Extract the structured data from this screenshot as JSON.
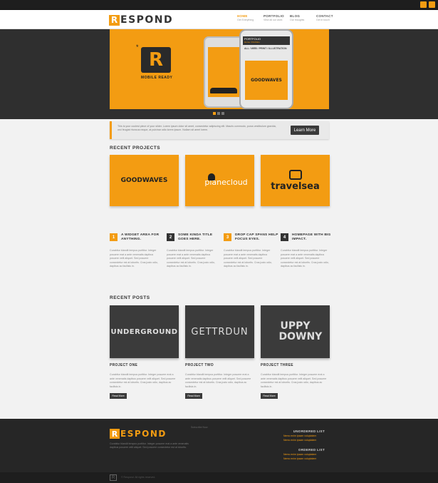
{
  "header": {
    "logo_letter": "R",
    "logo_text": "ESPOND",
    "nav": [
      {
        "label": "HOME",
        "sub": "Get Everything"
      },
      {
        "label": "PORTFOLIO",
        "sub": "View all our work"
      },
      {
        "label": "BLOG",
        "sub": "Our thoughts"
      },
      {
        "label": "CONTACT",
        "sub": "Get in touch"
      }
    ]
  },
  "slider": {
    "badge_letter": "R",
    "badge_star": "*",
    "mobile_ready": "MOBILE READY",
    "phone_bar": "PORTFOLIO",
    "phone_bar_sub": "Home / Portfolio",
    "phone_filter": "ALL / WEB / PRINT / ILLUSTRATION",
    "phone_screen": "GOODWAVES"
  },
  "callout": {
    "text": "This is your coolest piece of your slider. Lorem ipsum dolor sit amet, consectetur adipiscing elit. Mauris commodo, purus vestibulum gravida, orci feugiat rhoncus neque, at pulvinar odio lorem ipsum. Nullam sit amet lorem.",
    "button": "Learn More"
  },
  "recent_projects": {
    "title": "RECENT PROJECTS",
    "items": [
      {
        "label": "GOODWAVES"
      },
      {
        "label": "planecloud"
      },
      {
        "label": "travelsea"
      }
    ]
  },
  "widgets": [
    {
      "num": "1",
      "title": "A WIDGET AREA FOR ANYTHING.",
      "body": "Curabitur blandit tempus porttitor. Integer posuere erat a ante venenatis dapibus posuere velit aliquet. Sed posuere consectetur est at lobortis. Cras justo odio, dapibus ac facilisis in."
    },
    {
      "num": "2",
      "title": "SOME KINDA TITLE GOES HERE.",
      "body": "Curabitur blandit tempus porttitor. Integer posuere erat a ante venenatis dapibus posuere velit aliquet. Sed posuere consectetur est at lobortis. Cras justo odio, dapibus ac facilisis in."
    },
    {
      "num": "3",
      "title": "DROP CAP SPANS HELP FOCUS EYES.",
      "body": "Curabitur blandit tempus porttitor. Integer posuere erat a ante venenatis dapibus posuere velit aliquet. Sed posuere consectetur est at lobortis. Cras justo odio, dapibus ac facilisis in."
    },
    {
      "num": "4",
      "title": "HOMEPAGE WITH BIG IMPACT.",
      "body": "Curabitur blandit tempus porttitor. Integer posuere erat a ante venenatis dapibus posuere velit aliquet. Sed posuere consectetur est at lobortis. Cras justo odio, dapibus ac facilisis in."
    }
  ],
  "recent_posts": {
    "title": "RECENT POSTS",
    "items": [
      {
        "thumb": "UNDERGROUND",
        "title": "PROJECT ONE",
        "body": "Curabitur blandit tempus porttitor. Integer posuere erat a ante venenatis dapibus posuere velit aliquet. Sed posuere consectetur est at lobortis. Cras justo odio, dapibus ac facilisis in.",
        "button": "Read More"
      },
      {
        "thumb": "GETTRDUN",
        "title": "PROJECT TWO",
        "body": "Curabitur blandit tempus porttitor. Integer posuere erat a ante venenatis dapibus posuere velit aliquet. Sed posuere consectetur est at lobortis. Cras justo odio, dapibus ac facilisis in.",
        "button": "Read More"
      },
      {
        "thumb": "UPPY DOWNY",
        "title": "PROJECT THREE",
        "body": "Curabitur blandit tempus porttitor. Integer posuere erat a ante venenatis dapibus posuere velit aliquet. Sed posuere consectetur est at lobortis. Cras justo odio, dapibus ac facilisis in.",
        "button": "Read More"
      }
    ]
  },
  "footer": {
    "logo_letter": "R",
    "logo_text": "ESPOND",
    "text": "Curabitur blandit tempus porttitor. Integer posuere erat a ante venenatis dapibus posuere velit aliquet. Sed posuere consectetur est at lobortis.",
    "mid": "Subscribe Now",
    "list1_title": "UNORDERED LIST",
    "list1_items": [
      "Nemo enim ipsam voluptatem",
      "Nemo enim ipsam voluptatem"
    ],
    "list2_title": "ORDERED LIST",
    "list2_items": [
      "Nemo enim ipsam voluptatem",
      "Nemo enim ipsam voluptatem"
    ],
    "copyright": "© Respond. All rights reserved."
  },
  "colors": {
    "accent": "#f39c12",
    "dark": "#2a2a2a"
  }
}
